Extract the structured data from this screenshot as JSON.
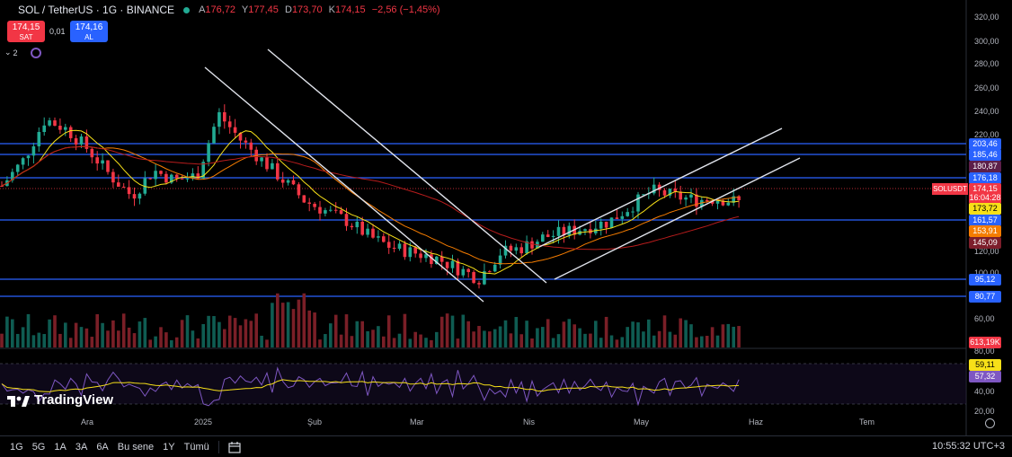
{
  "header": {
    "title": "SOL / TetherUS · 1G · BINANCE",
    "ohlc": [
      {
        "label": "A",
        "value": "176,72"
      },
      {
        "label": "Y",
        "value": "177,45"
      },
      {
        "label": "D",
        "value": "173,70"
      },
      {
        "label": "K",
        "value": "174,15"
      }
    ],
    "change": "−2,56 (−1,45%)"
  },
  "trade": {
    "sell_price": "174,15",
    "sell_label": "SAT",
    "spread": "0,01",
    "buy_price": "174,16",
    "buy_label": "AL"
  },
  "indicator_count": "2",
  "price_axis": [
    "320,00",
    "300,00",
    "280,00",
    "260,00",
    "240,00",
    "220,00",
    "120,00",
    "100,00",
    "60,00",
    "80,00",
    "60,00",
    "40,00",
    "20,00"
  ],
  "price_tags": [
    {
      "value": "203,46",
      "color": "#2962ff"
    },
    {
      "value": "185,46",
      "color": "#2962ff"
    },
    {
      "value": "180,87",
      "color": "#5c1f4a"
    },
    {
      "value": "176,18",
      "color": "#2962ff"
    },
    {
      "value": "174,15",
      "color": "#f23645"
    },
    {
      "value": "16:04:28",
      "color": "#f23645"
    },
    {
      "value": "173,72",
      "color": "#f7e018"
    },
    {
      "value": "161,57",
      "color": "#2962ff"
    },
    {
      "value": "153,91",
      "color": "#f57c00"
    },
    {
      "value": "145,09",
      "color": "#7d1e2b"
    },
    {
      "value": "95,12",
      "color": "#2962ff"
    },
    {
      "value": "80,77",
      "color": "#2962ff"
    },
    {
      "value": "613,19K",
      "color": "#f23645"
    },
    {
      "value": "59,11",
      "color": "#f7e018"
    },
    {
      "value": "57,32",
      "color": "#7e57c2"
    }
  ],
  "symbol_tag": "SOLUSDT",
  "time_axis": [
    "Ara",
    "2025",
    "Şub",
    "Mar",
    "Nis",
    "May",
    "Haz",
    "Tem"
  ],
  "timeframes": [
    "1G",
    "5G",
    "1A",
    "3A",
    "6A",
    "Bu sene",
    "1Y",
    "Tümü"
  ],
  "clock": "10:55:32 UTC+3",
  "brand": "TradingView",
  "colors": {
    "up": "#22ab94",
    "down": "#f23645",
    "line": "#2962ff",
    "ma_fast": "#f7e018",
    "ma_mid": "#f57c00",
    "ma_slow": "#b71c1c",
    "rsi": "#7e57c2"
  },
  "chart_data": {
    "type": "line",
    "title": "SOL / TetherUS · 1G · BINANCE",
    "xlabel": "",
    "ylabel": "",
    "x": [
      "Ara",
      "2025",
      "Şub",
      "Mar",
      "Nis",
      "May",
      "Haz"
    ],
    "series": [
      {
        "values": [
          190,
          215,
          255,
          245,
          225,
          200,
          180,
          205,
          195,
          200,
          260,
          235,
          215,
          195,
          175,
          165,
          155,
          140,
          130,
          125,
          120,
          110,
          100,
          125,
          130,
          140,
          145,
          150,
          155,
          170,
          185,
          180,
          176,
          178,
          174.15
        ]
      }
    ],
    "ylim": [
      20,
      320
    ],
    "horizontal_levels": [
      203.46,
      185.46,
      176.18,
      161.57,
      95.12,
      80.77
    ],
    "grid": false,
    "legend": "none"
  }
}
